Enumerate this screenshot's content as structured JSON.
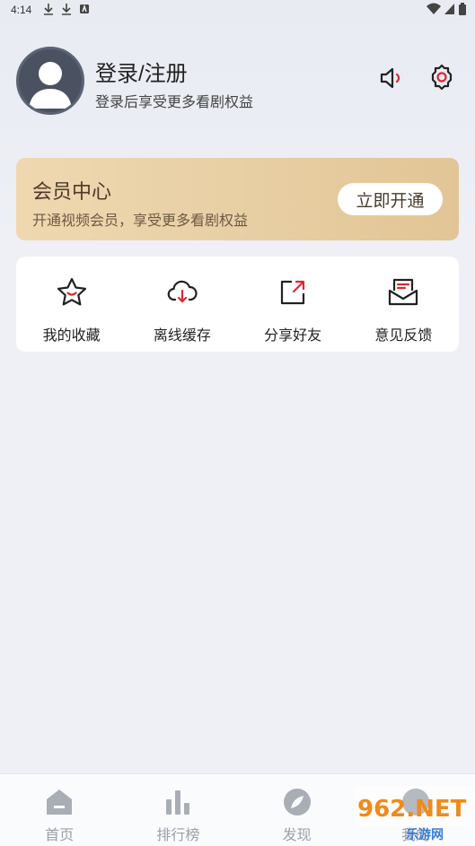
{
  "status_bar": {
    "time": "4:14"
  },
  "profile": {
    "name": "登录/注册",
    "subtitle": "登录后享受更多看剧权益"
  },
  "vip": {
    "title": "会员中心",
    "subtitle": "开通视频会员，享受更多看剧权益",
    "button_label": "立即开通"
  },
  "features": [
    {
      "label": "我的收藏",
      "icon": "star-icon"
    },
    {
      "label": "离线缓存",
      "icon": "cloud-download-icon"
    },
    {
      "label": "分享好友",
      "icon": "share-icon"
    },
    {
      "label": "意见反馈",
      "icon": "feedback-icon"
    }
  ],
  "bottom_nav": [
    {
      "label": "首页",
      "icon": "home-icon"
    },
    {
      "label": "排行榜",
      "icon": "ranking-icon"
    },
    {
      "label": "发现",
      "icon": "discover-icon"
    },
    {
      "label": "我的",
      "icon": "profile-icon"
    }
  ],
  "watermark": {
    "text": "962.NET",
    "subtext": "乐游网"
  },
  "colors": {
    "accent_red": "#e0262f",
    "vip_gold": "#e8cfa4",
    "nav_grey": "#9aa0aa"
  }
}
